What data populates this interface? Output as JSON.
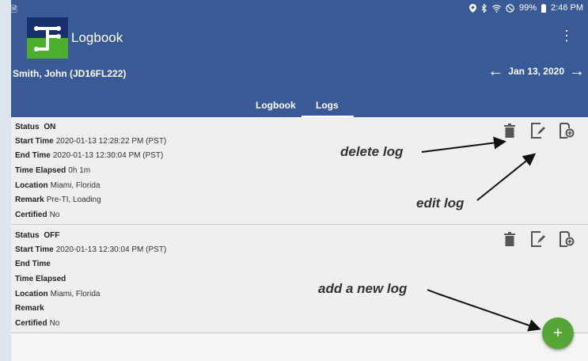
{
  "status_bar": {
    "left_glyph": "🖹",
    "battery": "99%",
    "time": "2:46 PM",
    "icons": [
      "location-icon",
      "bluetooth-icon",
      "wifi-icon",
      "block-icon",
      "battery-icon"
    ]
  },
  "app": {
    "title": "Logbook",
    "menu_glyph": "⋮",
    "driver": "Smith, John (JD16FL222)",
    "date": "Jan 13, 2020",
    "left_arrow": "←",
    "right_arrow": "→",
    "tabs": [
      {
        "label": "Logbook"
      },
      {
        "label": "Logs"
      }
    ]
  },
  "logs": [
    {
      "status_label": "Status",
      "status_value": "ON",
      "start_label": "Start Time",
      "start_value": "2020-01-13 12:28:22 PM (PST)",
      "end_label": "End Time",
      "end_value": "2020-01-13 12:30:04 PM (PST)",
      "elapsed_label": "Time Elapsed",
      "elapsed_value": "0h 1m",
      "location_label": "Location",
      "location_value": "Miami, Florida",
      "remark_label": "Remark",
      "remark_value": "Pre-TI, Loading",
      "certified_label": "Certified",
      "certified_value": "No"
    },
    {
      "status_label": "Status",
      "status_value": "OFF",
      "start_label": "Start Time",
      "start_value": "2020-01-13 12:30:04 PM (PST)",
      "end_label": "End Time",
      "end_value": "",
      "elapsed_label": "Time Elapsed",
      "elapsed_value": "",
      "location_label": "Location",
      "location_value": "Miami, Florida",
      "remark_label": "Remark",
      "remark_value": "",
      "certified_label": "Certified",
      "certified_value": "No"
    }
  ],
  "annotations": {
    "delete": "delete log",
    "edit": "edit log",
    "add": "add a new log"
  },
  "fab_label": "+",
  "colors": {
    "appbar": "#3a5a97",
    "fab": "#54a637",
    "icon": "#555555"
  }
}
